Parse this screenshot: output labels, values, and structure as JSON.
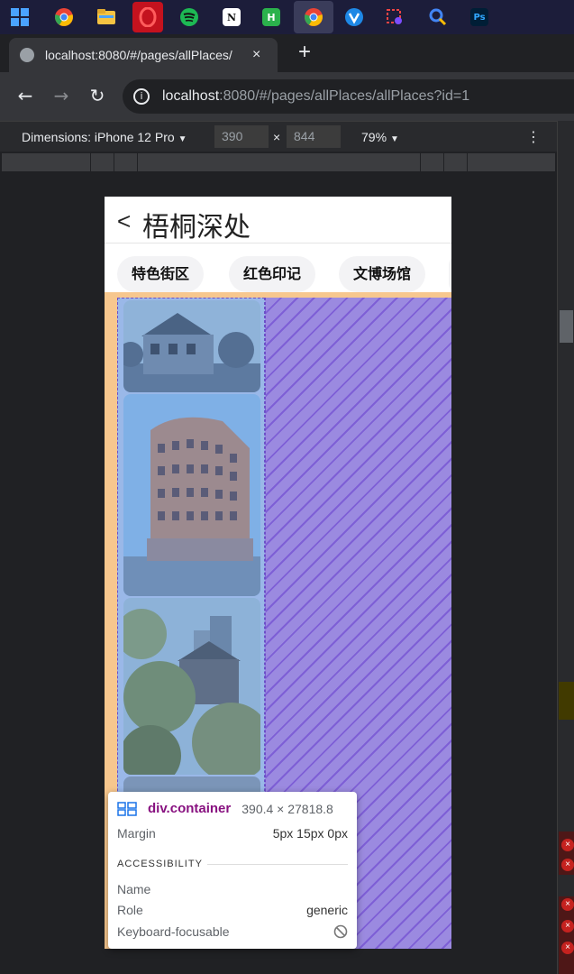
{
  "taskbar": {
    "icons": [
      "windows-start-icon",
      "chrome-icon",
      "file-explorer-icon",
      "opera-icon",
      "spotify-icon",
      "notion-icon",
      "hbuilder-icon",
      "chrome-active-icon",
      "vscode-alt-icon",
      "snipping-icon",
      "search-app-icon",
      "photoshop-icon"
    ]
  },
  "tab": {
    "title": "localhost:8080/#/pages/allPlaces/",
    "close": "×"
  },
  "newtab": "+",
  "address": {
    "host": "localhost",
    "rest": ":8080/#/pages/allPlaces/allPlaces?id=1"
  },
  "devicebar": {
    "dimensions_label": "Dimensions: iPhone 12 Pro",
    "width": "390",
    "height": "844",
    "times": "×",
    "zoom": "79%"
  },
  "app": {
    "back": "<",
    "title": "梧桐深处",
    "tabs": [
      "特色街区",
      "红色印记",
      "文博场馆"
    ]
  },
  "tooltip": {
    "selector": "div.container",
    "size": "390.4 × 27818.8",
    "margin_label": "Margin",
    "margin_value": "5px 15px 0px",
    "accessibility_header": "ACCESSIBILITY",
    "name_label": "Name",
    "name_value": "",
    "role_label": "Role",
    "role_value": "generic",
    "focusable_label": "Keyboard-focusable",
    "focusable_icon": "not-allowed-icon"
  },
  "colors": {
    "content_bg": "#f7c78e",
    "hatch_bg": "#9b8ae0",
    "selector": "#881280"
  }
}
